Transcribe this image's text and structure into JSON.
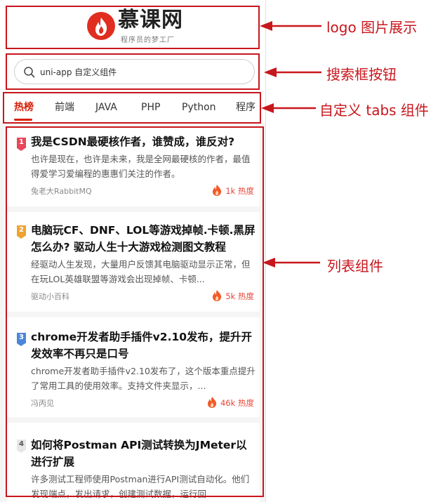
{
  "logo": {
    "name": "慕课网",
    "slogan": "程序员的梦工厂"
  },
  "search": {
    "value": "uni-app 自定义组件"
  },
  "tabs": [
    "热榜",
    "前端",
    "JAVA",
    "PHP",
    "Python",
    "程序"
  ],
  "list": [
    {
      "rank": "1",
      "title": "我是CSDN最硬核作者，谁赞成，谁反对?",
      "desc": "也许是现在，也许是未来，我是全网最硬核的作者，最值得爱学习爱编程的惠惠们关注的作者。",
      "author": "兔老大RabbitMQ",
      "hot": "1k 热度"
    },
    {
      "rank": "2",
      "title": "电脑玩CF、DNF、LOL等游戏掉帧.卡顿.黑屏怎么办? 驱动人生十大游戏检测图文教程",
      "desc": "经驱动人生发现，大量用户反馈其电脑驱动显示正常，但在玩LOL英雄联盟等游戏会出现掉帧、卡顿...",
      "author": "驱动小百科",
      "hot": "5k 热度"
    },
    {
      "rank": "3",
      "title": "chrome开发者助手插件v2.10发布，提升开发效率不再只是口号",
      "desc": "chrome开发者助手插件v2.10发布了，这个版本重点提升了常用工具的使用效率。支持文件夹显示，...",
      "author": "冯丙见",
      "hot": "46k 热度"
    },
    {
      "rank": "4",
      "title": "如何将Postman API测试转换为JMeter以进行扩展",
      "desc": "许多测试工程师使用Postman进行API测试自动化。他们发现端点，发出请求，创建测试数据，运行回...",
      "author": "",
      "hot": ""
    }
  ],
  "annotations": {
    "logo": "logo 图片展示",
    "search": "搜索框按钮",
    "tabs": "自定义 tabs 组件",
    "list": "列表组件"
  },
  "colors": {
    "accent": "#d81e06",
    "annotation": "#c8161d"
  }
}
